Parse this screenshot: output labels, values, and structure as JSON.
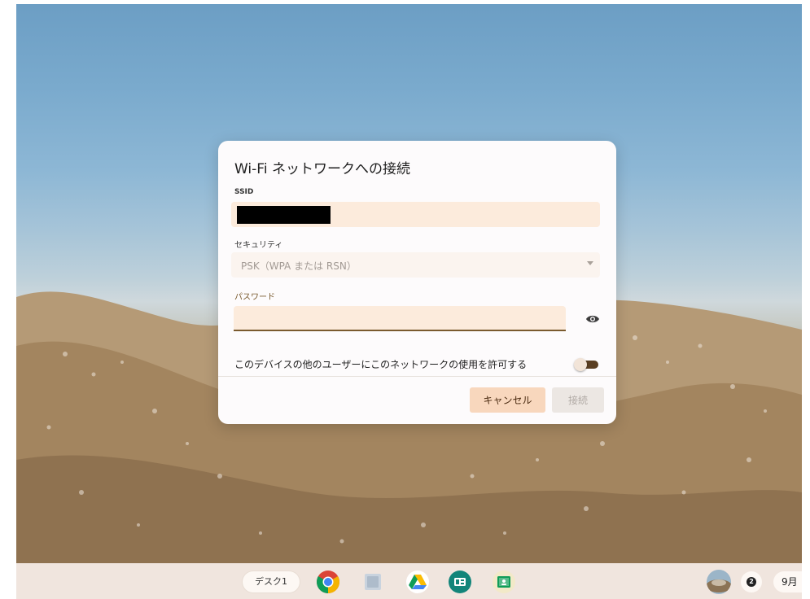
{
  "dialog": {
    "title": "Wi-Fi ネットワークへの接続",
    "ssid_label": "SSID",
    "ssid_value": "",
    "security_label": "セキュリティ",
    "security_value": "PSK（WPA または RSN）",
    "password_label": "パスワード",
    "password_value": "",
    "share_label": "このデバイスの他のユーザーにこのネットワークの使用を許可する",
    "share_enabled": false,
    "cancel_label": "キャンセル",
    "connect_label": "接続",
    "accent_color": "#7a5a2e",
    "cancel_color": "#f8d7bd"
  },
  "shelf": {
    "desk_label": "デスク1",
    "apps": [
      {
        "name": "chrome-icon"
      },
      {
        "name": "files-icon"
      },
      {
        "name": "drive-icon"
      },
      {
        "name": "meet-icon"
      },
      {
        "name": "classroom-icon"
      }
    ],
    "notification_count": "2",
    "clock_text": "9月"
  }
}
